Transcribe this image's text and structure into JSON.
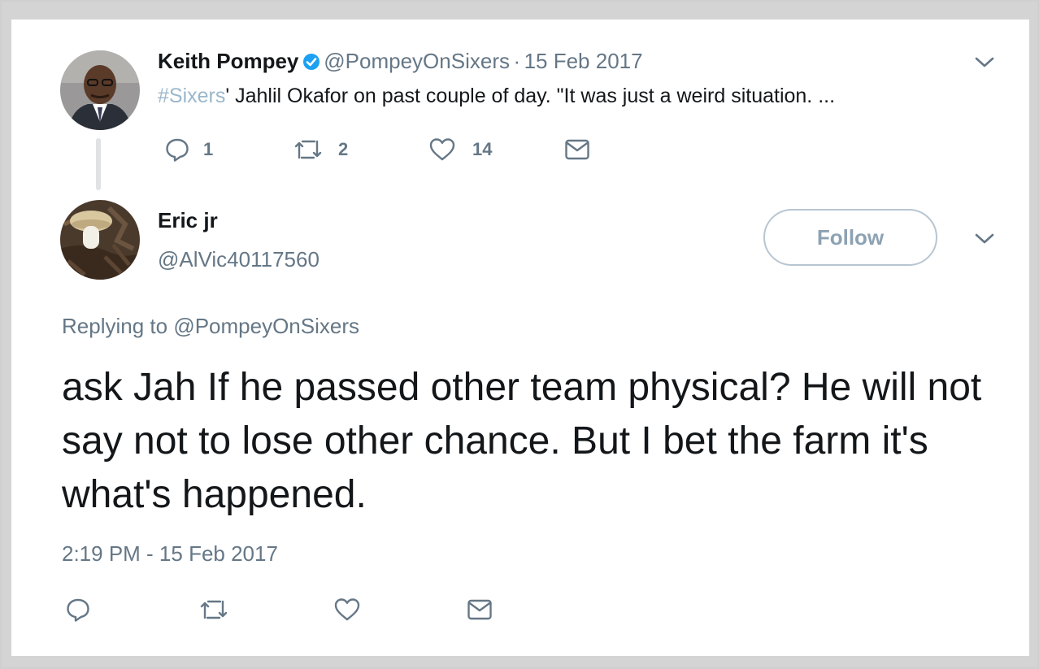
{
  "parent_tweet": {
    "author_name": "Keith Pompey",
    "author_handle": "@PompeyOnSixers",
    "separator": "·",
    "date": "15 Feb 2017",
    "hashtag": "#Sixers",
    "text_rest": "' Jahlil Okafor on past couple of day. \"It was just a weird situation. ...",
    "stats": {
      "replies": "1",
      "retweets": "2",
      "likes": "14"
    }
  },
  "reply_tweet": {
    "author_name": "Eric jr",
    "author_handle": "@AlVic40117560",
    "follow_label": "Follow",
    "replying_prefix": "Replying to",
    "replying_handle": "@PompeyOnSixers",
    "text": "ask Jah If he passed other team physical? He will not say not to lose other chance. But I bet the farm it's what's happened.",
    "timestamp": "2:19 PM - 15 Feb 2017"
  },
  "colors": {
    "accent": "#1da1f2",
    "muted": "#657786",
    "hashtag": "#9bb7cc",
    "text": "#14171a"
  },
  "icons": [
    "verified-badge-icon",
    "reply-icon",
    "retweet-icon",
    "like-icon",
    "dm-icon",
    "chevron-down-icon"
  ]
}
